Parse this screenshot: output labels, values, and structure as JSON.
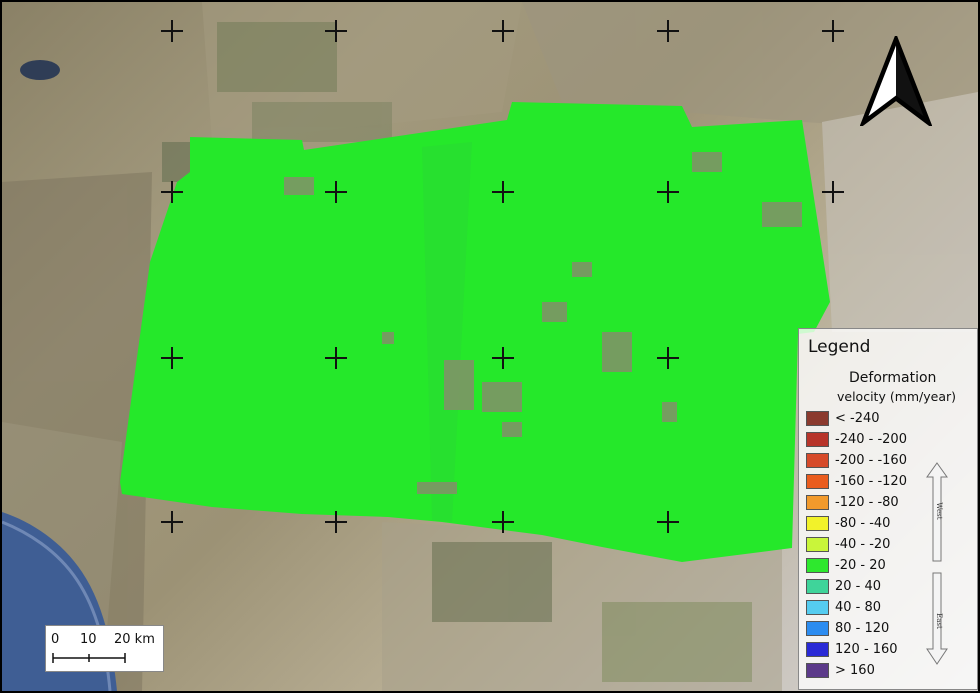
{
  "map": {
    "crosshair_marks": 15
  },
  "north_arrow": {
    "icon": "north-arrow-icon"
  },
  "legend": {
    "title": "Legend",
    "subtitle_line1": "Deformation",
    "subtitle_line2": "velocity (mm/year)",
    "items": [
      {
        "label": "< -240",
        "color": "#8b3a2e"
      },
      {
        "label": "-240 - -200",
        "color": "#b7342a"
      },
      {
        "label": "-200 - -160",
        "color": "#d64a2a"
      },
      {
        "label": "-160 - -120",
        "color": "#ea5c1e"
      },
      {
        "label": "-120 - -80",
        "color": "#f29a2c"
      },
      {
        "label": "-80 - -40",
        "color": "#f2f22a"
      },
      {
        "label": "-40 - -20",
        "color": "#c9f53a"
      },
      {
        "label": "-20 - 20",
        "color": "#2ee82e"
      },
      {
        "label": "20 - 40",
        "color": "#3fd49a"
      },
      {
        "label": "40 - 80",
        "color": "#55ccf0"
      },
      {
        "label": "80 - 120",
        "color": "#2c8cf0"
      },
      {
        "label": "120 - 160",
        "color": "#2a2ad6"
      },
      {
        "label": "> 160",
        "color": "#5c3a8a"
      }
    ],
    "direction_top": "West",
    "direction_bottom": "East"
  },
  "scalebar": {
    "labels": [
      "0",
      "10",
      "20 km"
    ]
  }
}
